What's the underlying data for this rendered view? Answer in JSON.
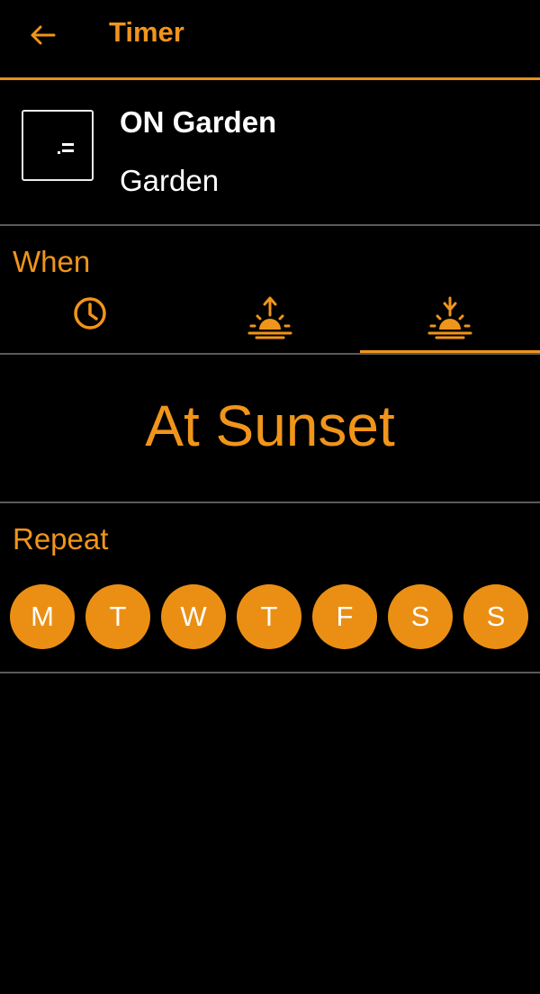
{
  "colors": {
    "accent": "#f0951b",
    "background": "#000000",
    "day_fill": "#eb8f14",
    "divider": "#5a5a5a"
  },
  "header": {
    "title": "Timer",
    "back_icon": "arrow-left-icon"
  },
  "device": {
    "name": "ON Garden",
    "room": "Garden",
    "icon": "device-outlet-icon"
  },
  "when": {
    "label": "When",
    "tabs": [
      {
        "icon": "clock-icon",
        "selected": false
      },
      {
        "icon": "sunrise-icon",
        "selected": false
      },
      {
        "icon": "sunset-icon",
        "selected": true
      }
    ],
    "value": "At Sunset"
  },
  "repeat": {
    "label": "Repeat",
    "days": [
      {
        "label": "M",
        "selected": true
      },
      {
        "label": "T",
        "selected": true
      },
      {
        "label": "W",
        "selected": true
      },
      {
        "label": "T",
        "selected": true
      },
      {
        "label": "F",
        "selected": true
      },
      {
        "label": "S",
        "selected": true
      },
      {
        "label": "S",
        "selected": true
      }
    ]
  }
}
